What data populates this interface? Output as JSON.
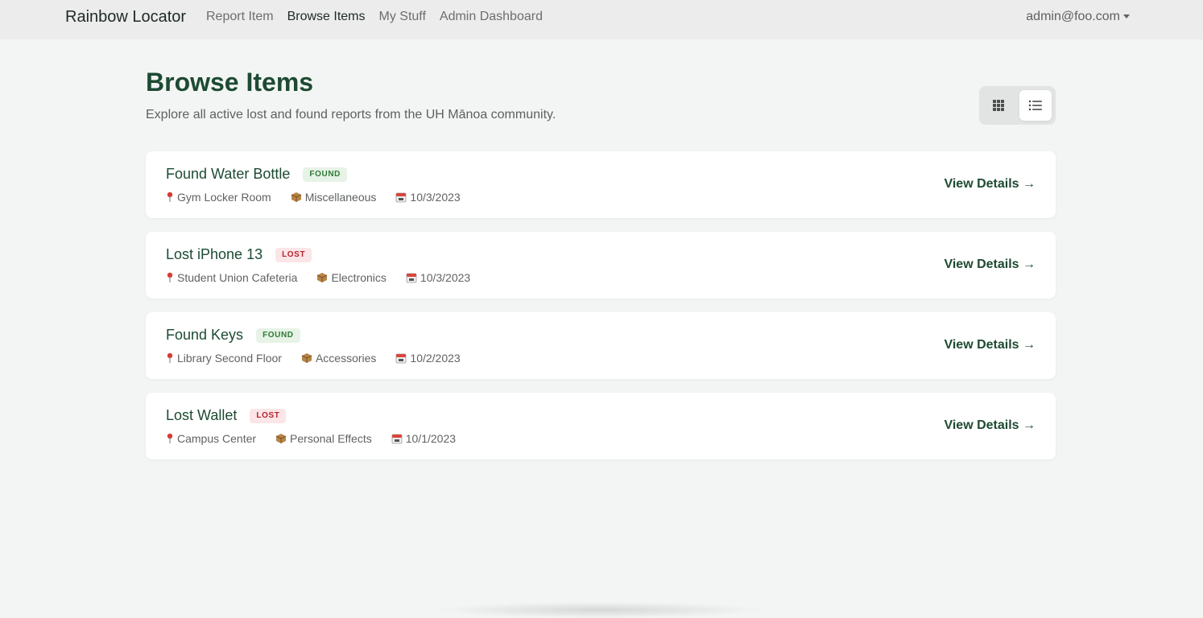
{
  "nav": {
    "brand": "Rainbow Locator",
    "links": [
      {
        "label": "Report Item"
      },
      {
        "label": "Browse Items"
      },
      {
        "label": "My Stuff"
      },
      {
        "label": "Admin Dashboard"
      }
    ],
    "active_link": "Browse Items",
    "user": "admin@foo.com"
  },
  "header": {
    "title": "Browse Items",
    "subtitle": "Explore all active lost and found reports from the UH Mānoa community."
  },
  "view_toggle": {
    "options": [
      "grid-icon",
      "list-icon"
    ],
    "selected": "list"
  },
  "items": [
    {
      "title": "Found Water Bottle",
      "status": "FOUND",
      "location": "Gym Locker Room",
      "category": "Miscellaneous",
      "date": "10/3/2023",
      "action": "View Details →"
    },
    {
      "title": "Lost iPhone 13",
      "status": "LOST",
      "location": "Student Union Cafeteria",
      "category": "Electronics",
      "date": "10/3/2023",
      "action": "View Details →"
    },
    {
      "title": "Found Keys",
      "status": "FOUND",
      "location": "Library Second Floor",
      "category": "Accessories",
      "date": "10/2/2023",
      "action": "View Details →"
    },
    {
      "title": "Lost Wallet",
      "status": "LOST",
      "location": "Campus Center",
      "category": "Personal Effects",
      "date": "10/1/2023",
      "action": "View Details →"
    }
  ],
  "colors": {
    "primary": "#1d4a33",
    "found_badge_bg": "#e6f3e6",
    "found_badge_text": "#2d7a35",
    "lost_badge_bg": "#fbe5e7",
    "lost_badge_text": "#b4232f",
    "page_bg": "#f3f5f4",
    "navbar_bg": "#ececec"
  }
}
